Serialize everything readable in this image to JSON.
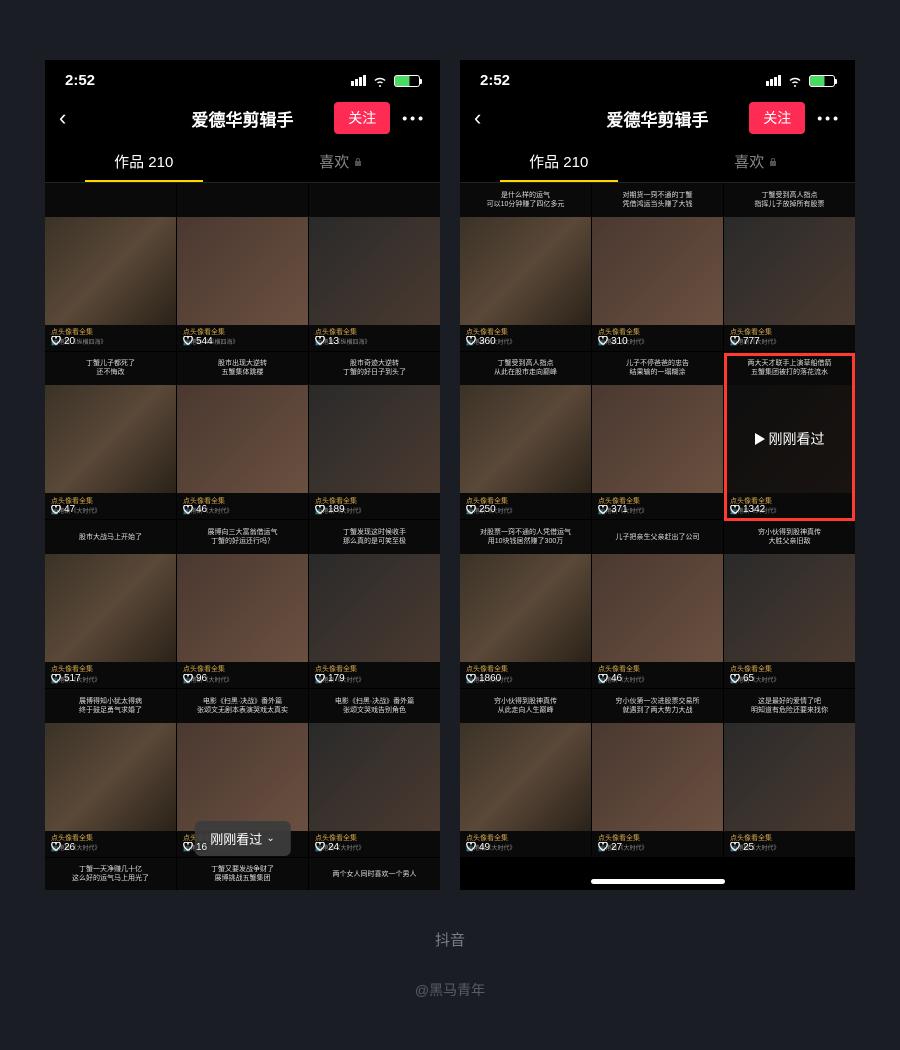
{
  "status": {
    "time": "2:52"
  },
  "nav": {
    "title": "爱德华剪辑手",
    "follow": "关注",
    "more": "•••"
  },
  "tabs": {
    "works": "作品 210",
    "likes": "喜欢"
  },
  "recent_pill": "刚刚看过",
  "recent_overlay": "刚刚看过",
  "caption": "抖音",
  "credit": "@黑马青年",
  "label": {
    "full": "点头像看全集",
    "sub1": "📺港剧《纵横四海》",
    "sub2": "📺港剧《大时代》"
  },
  "left_cells": [
    {
      "t1": "",
      "t2": "",
      "likes": "20"
    },
    {
      "t1": "",
      "t2": "",
      "likes": "544"
    },
    {
      "t1": "",
      "t2": "",
      "likes": "13"
    },
    {
      "t1": "丁蟹儿子都死了",
      "t2": "还不悔改",
      "likes": "47"
    },
    {
      "t1": "股市出现大逆转",
      "t2": "五蟹集体跳楼",
      "likes": "46"
    },
    {
      "t1": "股市奇迹大逆转",
      "t2": "丁蟹的好日子到头了",
      "likes": "189"
    },
    {
      "t1": "股市大战马上开始了",
      "t2": "",
      "likes": "517"
    },
    {
      "t1": "展博向三大富翁借运气",
      "t2": "丁蟹的好运还行吗？",
      "likes": "96"
    },
    {
      "t1": "丁蟹发现这时候收手",
      "t2": "那么真的是可笑至极",
      "likes": "179"
    },
    {
      "t1": "展博得知小犹太得病",
      "t2": "终于鼓足勇气求婚了",
      "likes": "26"
    },
    {
      "t1": "电影《扫黑·决战》番外篇",
      "t2": "张颂文无剧本表演哭戏太真实",
      "likes": "16"
    },
    {
      "t1": "电影《扫黑·决战》番外篇",
      "t2": "张颂文哭戏告别角色",
      "likes": "24"
    },
    {
      "t1": "丁蟹一天净赚几十亿",
      "t2": "这么好的运气马上用光了",
      "likes": ""
    },
    {
      "t1": "丁蟹又要发战争财了",
      "t2": "展博挑战五蟹集团",
      "likes": ""
    },
    {
      "t1": "两个女人同时喜欢一个男人",
      "t2": "",
      "likes": ""
    }
  ],
  "right_cells": [
    {
      "t1": "是什么样的运气",
      "t2": "可以10分钟赚了四亿多元",
      "likes": "360"
    },
    {
      "t1": "对期货一窍不通的丁蟹",
      "t2": "凭借鸿运当头赚了大钱",
      "likes": "310"
    },
    {
      "t1": "丁蟹受到高人指点",
      "t2": "指挥儿子放掉所有股票",
      "likes": "777"
    },
    {
      "t1": "丁蟹受到高人指点",
      "t2": "从此在股市走向巅峰",
      "likes": "250"
    },
    {
      "t1": "儿子不停爸爸的忠告",
      "t2": "结果输的一塌糊涂",
      "likes": "371"
    },
    {
      "t1": "两大天才联手上演草船借箭",
      "t2": "五蟹集团被打的落花流水",
      "likes": "1342"
    },
    {
      "t1": "对股票一窍不通的人凭借运气",
      "t2": "用10块钱居然赚了300万",
      "likes": "1860"
    },
    {
      "t1": "儿子把亲生父亲赶出了公司",
      "t2": "",
      "likes": "46"
    },
    {
      "t1": "穷小伙得到股神真传",
      "t2": "大胜父亲旧敌",
      "likes": "65"
    },
    {
      "t1": "穷小伙得到股神真传",
      "t2": "从此走向人生巅峰",
      "likes": "49"
    },
    {
      "t1": "穷小伙第一次进股票交易所",
      "t2": "就遇到了两大势力大战",
      "likes": "27"
    },
    {
      "t1": "这是最好的爱情了吧",
      "t2": "明知道有危险还要来找你",
      "likes": "25"
    }
  ]
}
